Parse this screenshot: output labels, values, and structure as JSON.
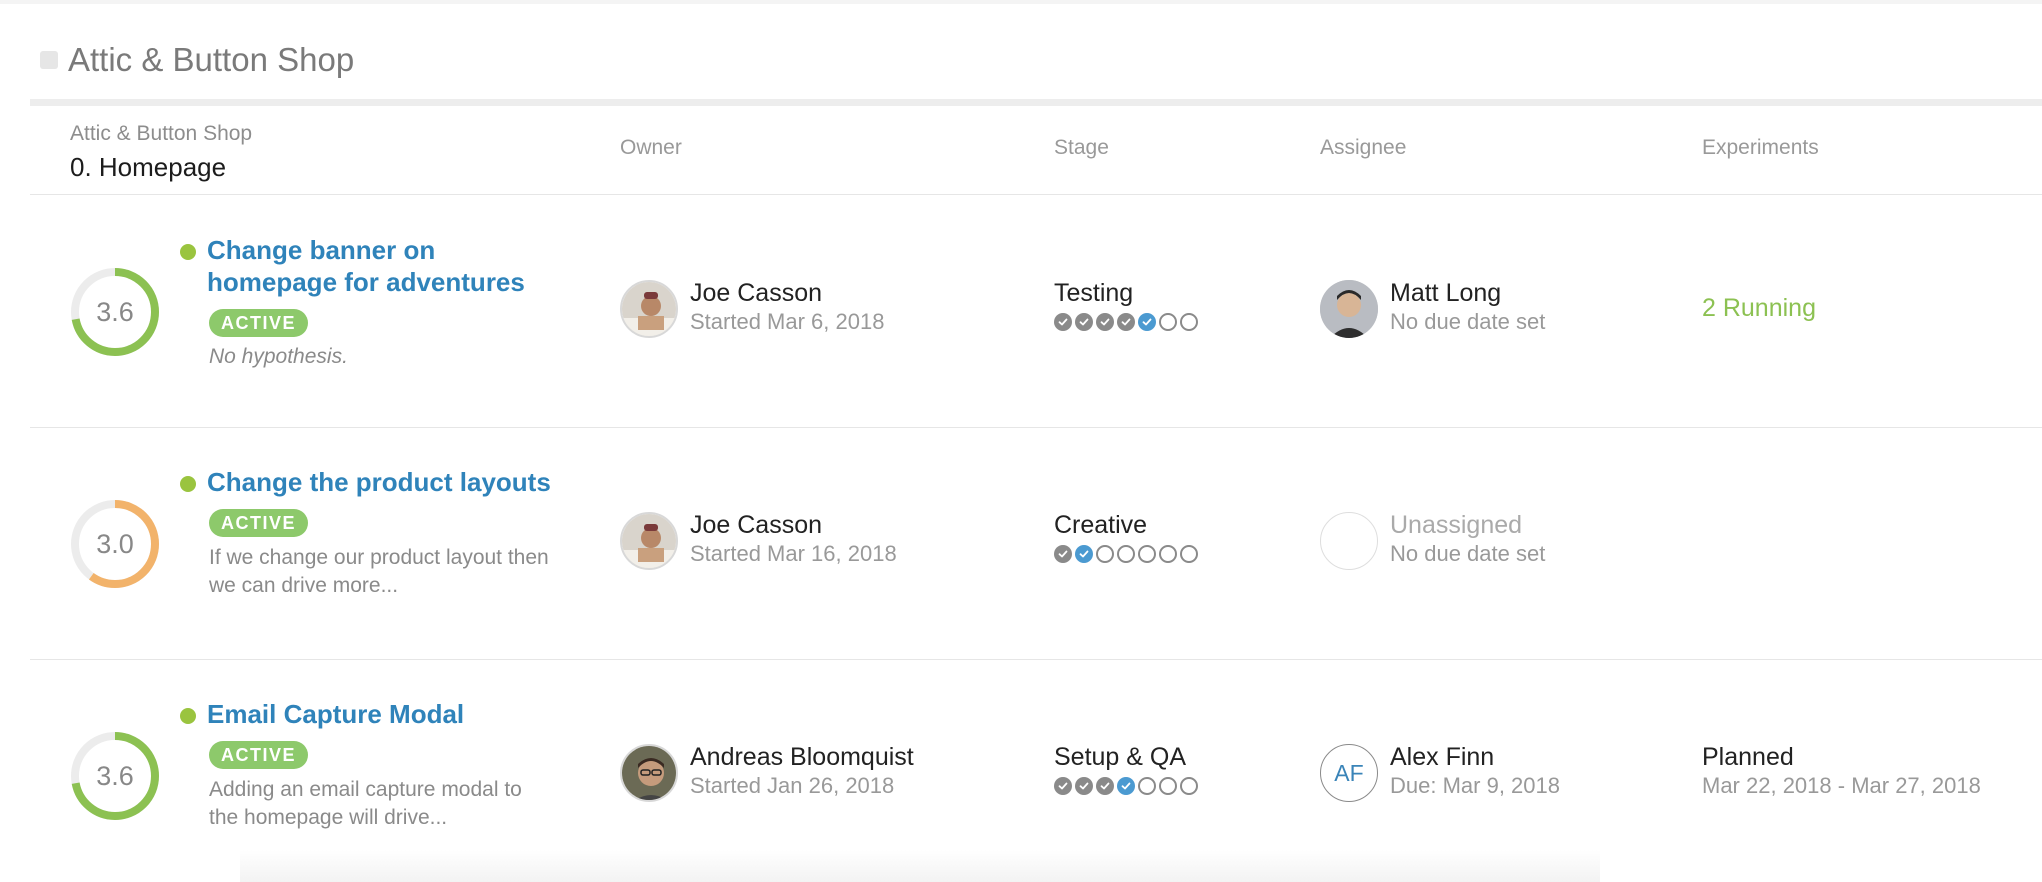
{
  "page": {
    "title": "Attic & Button Shop"
  },
  "table": {
    "header": {
      "project": "Attic & Button Shop",
      "page_group": "0. Homepage",
      "owner": "Owner",
      "stage": "Stage",
      "assignee": "Assignee",
      "experiments": "Experiments"
    },
    "rows": [
      {
        "score": "3.6",
        "score_fraction": 0.72,
        "score_color": "#8cc152",
        "title": "Change banner on homepage for adventures",
        "badge": "ACTIVE",
        "description": "No hypothesis.",
        "owner_name": "Joe Casson",
        "owner_started": "Started Mar 6, 2018",
        "stage_name": "Testing",
        "stage_steps": [
          "done",
          "done",
          "done",
          "done",
          "current",
          "todo",
          "todo"
        ],
        "assignee_name": "Matt Long",
        "assignee_due": "No due date set",
        "experiments_status": "2 Running",
        "experiments_color": "#8cc152"
      },
      {
        "score": "3.0",
        "score_fraction": 0.6,
        "score_color": "#f2b36b",
        "title": "Change the product layouts",
        "badge": "ACTIVE",
        "description": "If we change our product layout then we can drive more...",
        "owner_name": "Joe Casson",
        "owner_started": "Started Mar 16, 2018",
        "stage_name": "Creative",
        "stage_steps": [
          "done",
          "current",
          "todo",
          "todo",
          "todo",
          "todo",
          "todo"
        ],
        "assignee_name": "Unassigned",
        "assignee_due": "No due date set"
      },
      {
        "score": "3.6",
        "score_fraction": 0.72,
        "score_color": "#8cc152",
        "title": "Email Capture Modal",
        "badge": "ACTIVE",
        "description": "Adding an email capture modal to the homepage will drive...",
        "owner_name": "Andreas Bloomquist",
        "owner_started": "Started Jan 26, 2018",
        "stage_name": "Setup & QA",
        "stage_steps": [
          "done",
          "done",
          "done",
          "current",
          "todo",
          "todo",
          "todo"
        ],
        "assignee_initials": "AF",
        "assignee_name": "Alex Finn",
        "assignee_due": "Due: Mar 9, 2018",
        "experiments_status": "Planned",
        "experiments_color": "#222222",
        "experiments_dates": "Mar 22, 2018 - Mar 27, 2018"
      }
    ]
  },
  "colors": {
    "link": "#2f83ba",
    "active_badge": "#8dc96b",
    "status_dot": "#9ac43f",
    "stage_done": "#8a8a8a",
    "stage_current": "#4b9ad1"
  }
}
